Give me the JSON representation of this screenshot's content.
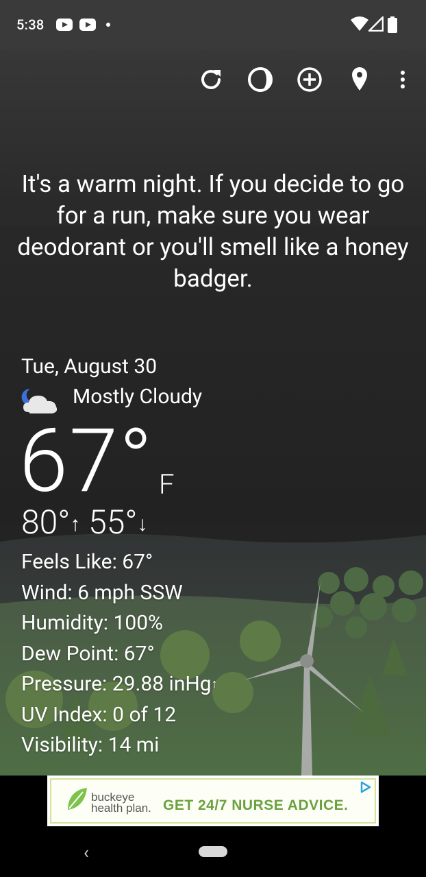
{
  "status_bar": {
    "time": "5:38",
    "notification_icons": [
      "youtube-icon",
      "youtube-icon",
      "dot-icon"
    ],
    "system_icons": [
      "wifi-icon",
      "signal-icon",
      "battery-icon"
    ]
  },
  "toolbar": {
    "actions": [
      {
        "name": "refresh-icon"
      },
      {
        "name": "theme-icon"
      },
      {
        "name": "add-location-icon"
      },
      {
        "name": "location-pin-icon"
      },
      {
        "name": "more-options-icon"
      }
    ]
  },
  "forecast_message": "It's a warm night. If you decide to go for a run, make sure you wear deodorant or you'll smell like a honey badger.",
  "weather": {
    "date": "Tue, August 30",
    "condition": "Mostly Cloudy",
    "condition_icon": "moon-cloud-icon",
    "temperature": "67°",
    "unit": "F",
    "high": "80°",
    "high_arrow": "↑",
    "low": "55°",
    "low_arrow": "↓"
  },
  "details": {
    "feels_like": "Feels Like:  67°",
    "wind": "Wind:  6 mph SSW",
    "humidity": "Humidity:  100%",
    "dew_point": "Dew Point:  67°",
    "pressure": "Pressure:  29.88 inHg",
    "pressure_arrow": "↑",
    "uv_index": "UV Index:  0 of 12",
    "visibility": "Visibility:  14 mi"
  },
  "ad": {
    "brand_line1": "buckeye",
    "brand_line2": "health plan.",
    "cta": "GET 24/7 NURSE ADVICE.",
    "brand_color": "#6aa13e"
  },
  "nav_bar": {
    "back_glyph": "‹"
  }
}
